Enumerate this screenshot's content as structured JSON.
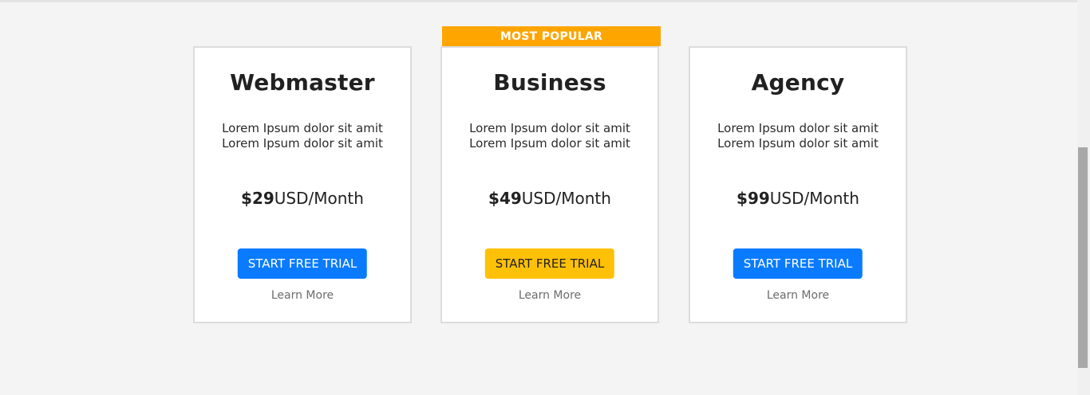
{
  "pricing": {
    "badge": "MOST POPULAR",
    "plans": [
      {
        "name": "Webmaster",
        "desc_line1": "Lorem Ipsum dolor sit amit",
        "desc_line2": "Lorem Ipsum dolor sit amit",
        "price": "$29",
        "unit": "USD/Month",
        "button": "START FREE TRIAL",
        "learn": "Learn More",
        "button_color": "#0a7bff"
      },
      {
        "name": "Business",
        "desc_line1": "Lorem Ipsum dolor sit amit",
        "desc_line2": "Lorem Ipsum dolor sit amit",
        "price": "$49",
        "unit": "USD/Month",
        "button": "START FREE TRIAL",
        "learn": "Learn More",
        "button_color": "#ffc107"
      },
      {
        "name": "Agency",
        "desc_line1": "Lorem Ipsum dolor sit amit",
        "desc_line2": "Lorem Ipsum dolor sit amit",
        "price": "$99",
        "unit": "USD/Month",
        "button": "START FREE TRIAL",
        "learn": "Learn More",
        "button_color": "#0a7bff"
      }
    ]
  },
  "colors": {
    "background": "#f4f4f4",
    "badge": "#ffa500",
    "primary": "#0a7bff",
    "warning": "#ffc107"
  }
}
